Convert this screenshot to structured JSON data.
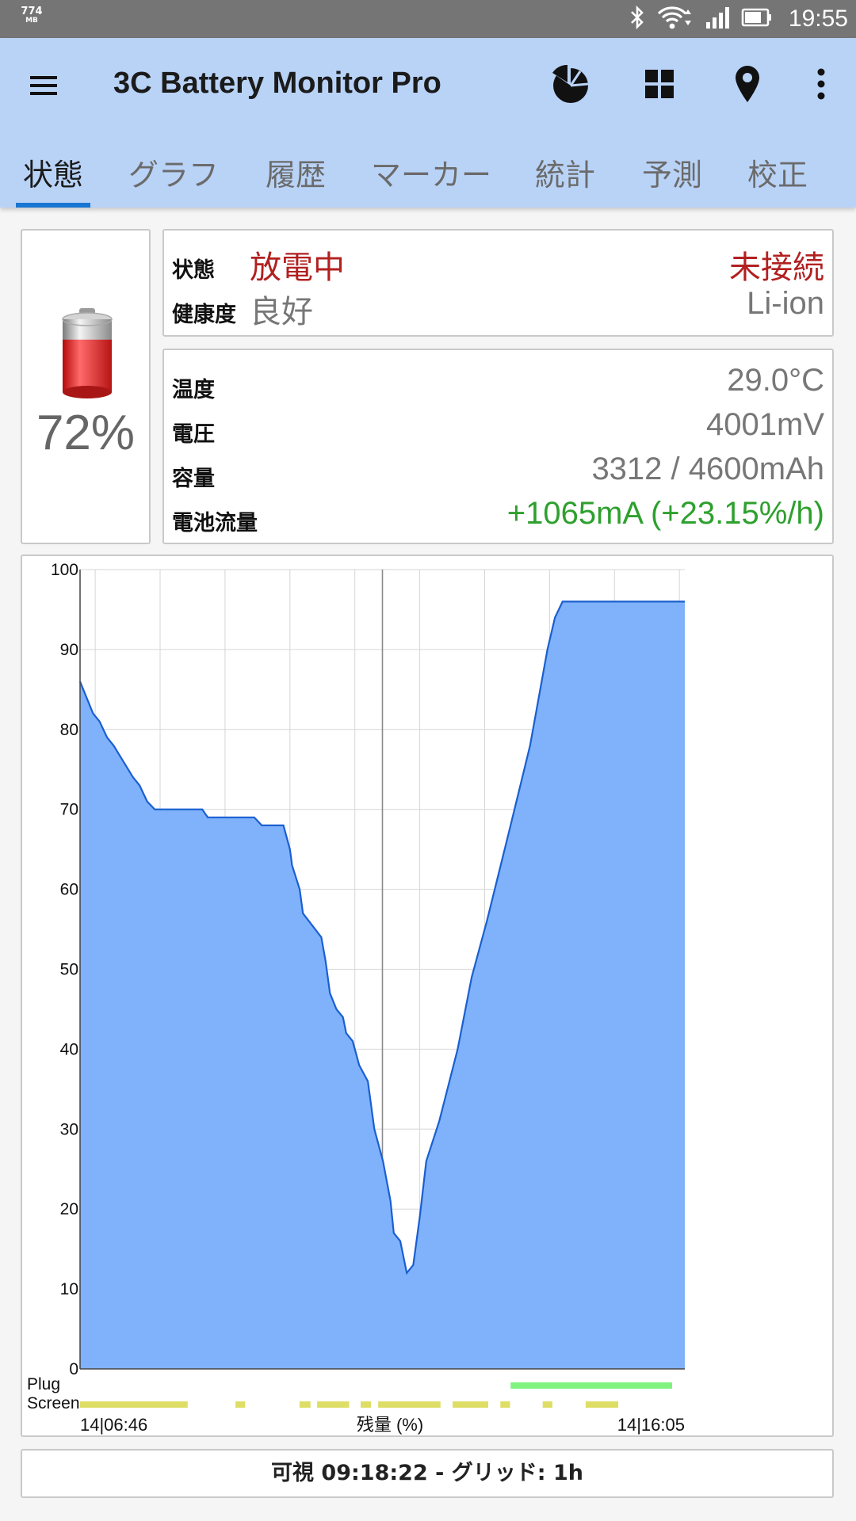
{
  "status_bar": {
    "memory_value": "774",
    "memory_unit": "MB",
    "time": "19:55",
    "icons": [
      "bluetooth-icon",
      "wifi-icon",
      "signal-icon",
      "battery-status-icon"
    ]
  },
  "app_bar": {
    "title": "3C Battery Monitor Pro",
    "actions": [
      "pie-chart-icon",
      "widget-grid-icon",
      "location-pin-icon",
      "overflow-menu-icon"
    ]
  },
  "tabs": [
    {
      "label": "状態",
      "active": true
    },
    {
      "label": "グラフ",
      "active": false
    },
    {
      "label": "履歴",
      "active": false
    },
    {
      "label": "マーカー",
      "active": false
    },
    {
      "label": "統計",
      "active": false
    },
    {
      "label": "予測",
      "active": false
    },
    {
      "label": "校正",
      "active": false
    }
  ],
  "battery": {
    "icon": "battery-level-icon",
    "level_text": "72%",
    "level": 0.72
  },
  "status_card": {
    "state_label": "状態",
    "state_value": "放電中",
    "plug_value": "未接続",
    "health_label": "健康度",
    "health_value": "良好",
    "type_value": "Li-ion"
  },
  "details_card": {
    "temp_label": "温度",
    "temp_value": "29.0°C",
    "voltage_label": "電圧",
    "voltage_value": "4001mV",
    "capacity_label": "容量",
    "capacity_value": "3312 / 4600mAh",
    "current_label": "電池流量",
    "current_value": "+1065mA (+23.15%/h)"
  },
  "colors": {
    "status_bar": "#757575",
    "app_bar": "#b9d3f7",
    "accent": "#1976d2",
    "discharging_red": "#b22020",
    "charging_green": "#2ea02e",
    "area_fill": "#7fb2fb",
    "area_line": "#1a5fcf",
    "plug_bar": "#7ff27f",
    "screen_bar": "#dede66"
  },
  "chart_data": {
    "type": "area",
    "xlabel": "残量 (%)",
    "x_start_label": "14|06:46",
    "x_end_label": "14|16:05",
    "ylim": [
      0,
      100
    ],
    "yticks": [
      0,
      10,
      20,
      30,
      40,
      50,
      60,
      70,
      80,
      90,
      100
    ],
    "grid": true,
    "series": [
      {
        "points": [
          [
            "06:46",
            86
          ],
          [
            "06:58",
            82
          ],
          [
            "07:04",
            81
          ],
          [
            "07:11",
            79
          ],
          [
            "07:17",
            78
          ],
          [
            "07:35",
            74
          ],
          [
            "07:41",
            73
          ],
          [
            "07:48",
            71
          ],
          [
            "07:55",
            70
          ],
          [
            "08:39",
            70
          ],
          [
            "08:44",
            69
          ],
          [
            "09:27",
            69
          ],
          [
            "09:34",
            68
          ],
          [
            "09:54",
            68
          ],
          [
            "10:00",
            65
          ],
          [
            "10:02",
            63
          ],
          [
            "10:09",
            60
          ],
          [
            "10:12",
            57
          ],
          [
            "10:29",
            54
          ],
          [
            "10:33",
            51
          ],
          [
            "10:37",
            47
          ],
          [
            "10:43",
            45
          ],
          [
            "10:49",
            44
          ],
          [
            "10:52",
            42
          ],
          [
            "10:58",
            41
          ],
          [
            "11:04",
            38
          ],
          [
            "11:12",
            36
          ],
          [
            "11:18",
            30
          ],
          [
            "11:26",
            26
          ],
          [
            "11:33",
            21
          ],
          [
            "11:36",
            17
          ],
          [
            "11:42",
            16
          ],
          [
            "11:48",
            12
          ],
          [
            "11:54",
            13
          ],
          [
            "12:00",
            19
          ],
          [
            "12:06",
            26
          ],
          [
            "12:18",
            31
          ],
          [
            "12:35",
            40
          ],
          [
            "12:48",
            49
          ],
          [
            "13:02",
            56
          ],
          [
            "13:24",
            68
          ],
          [
            "13:42",
            78
          ],
          [
            "13:58",
            90
          ],
          [
            "14:05",
            94
          ],
          [
            "14:12",
            96
          ],
          [
            "16:05",
            96
          ]
        ]
      }
    ],
    "tracks": [
      {
        "label": "Plug",
        "segments_fraction": [
          [
            0.712,
            0.979
          ]
        ],
        "color": "#7ff27f"
      },
      {
        "label": "Screen",
        "segments_fraction": [
          [
            0.0,
            0.178
          ],
          [
            0.257,
            0.273
          ],
          [
            0.363,
            0.381
          ],
          [
            0.392,
            0.445
          ],
          [
            0.464,
            0.481
          ],
          [
            0.493,
            0.596
          ],
          [
            0.616,
            0.675
          ],
          [
            0.695,
            0.711
          ],
          [
            0.765,
            0.781
          ],
          [
            0.836,
            0.89
          ]
        ],
        "color": "#dede66"
      }
    ]
  },
  "footer": {
    "text": "可視 09:18:22 - グリッド: 1h"
  }
}
